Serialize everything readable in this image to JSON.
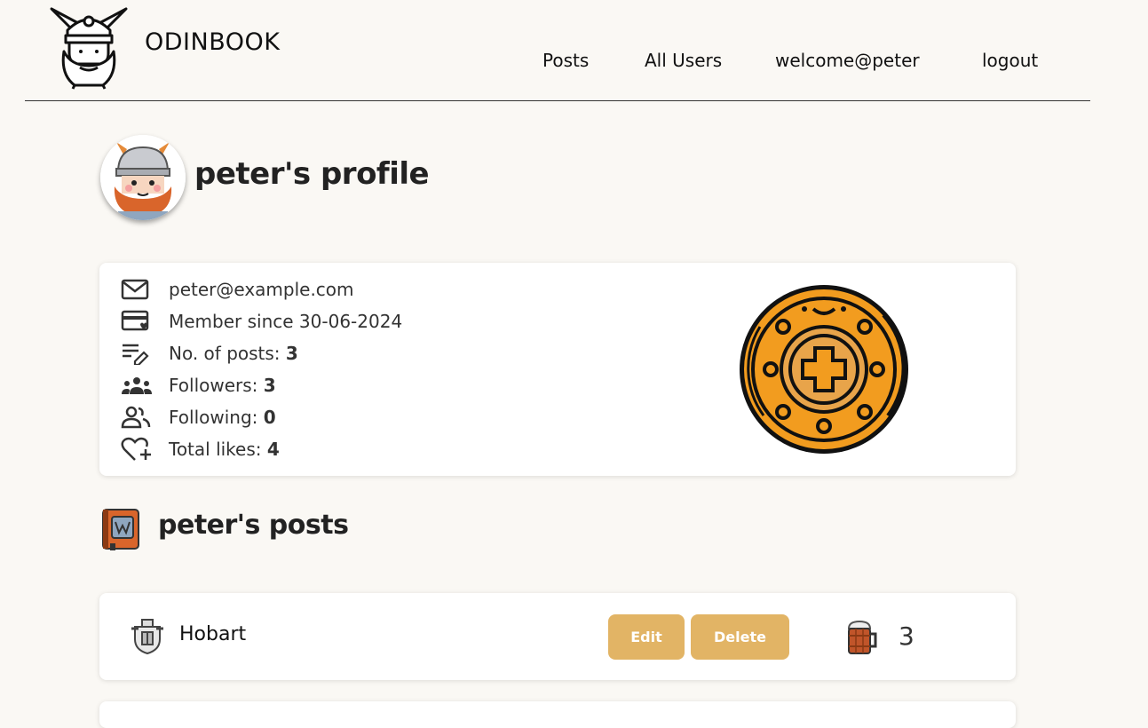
{
  "header": {
    "brand": "ODINBOOK",
    "nav": {
      "posts": "Posts",
      "all_users": "All Users",
      "welcome": "welcome@peter",
      "logout": "logout"
    }
  },
  "profile": {
    "title": "peter's profile",
    "email": "peter@example.com",
    "member_since": "Member since 30-06-2024",
    "posts_label": "No. of posts: ",
    "posts_count": "3",
    "followers_label": "Followers: ",
    "followers_count": "3",
    "following_label": "Following: ",
    "following_count": "0",
    "likes_label": "Total likes: ",
    "likes_count": "4"
  },
  "posts_section": {
    "title": "peter's posts",
    "items": [
      {
        "title": "Hobart",
        "edit_label": "Edit",
        "delete_label": "Delete",
        "likes": "3"
      }
    ]
  },
  "colors": {
    "background": "#faf8f4",
    "button": "#e2b465",
    "shield": "#f29c1f"
  }
}
